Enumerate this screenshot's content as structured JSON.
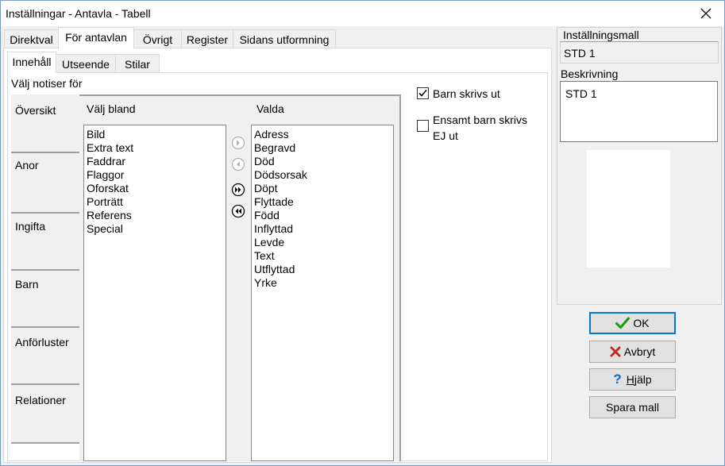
{
  "window": {
    "title": "Inställningar - Antavla - Tabell"
  },
  "main_tabs": [
    "Direktval",
    "För antavlan",
    "Övrigt",
    "Register",
    "Sidans utformning"
  ],
  "sub_tabs": [
    "Innehåll",
    "Utseende",
    "Stilar"
  ],
  "section_label": "Välj notiser för",
  "nav_items": [
    "Översikt",
    "Anor",
    "Ingifta",
    "Barn",
    "Anförluster",
    "Relationer"
  ],
  "choose_from": {
    "header": "Välj bland",
    "items": [
      "Bild",
      "Extra text",
      "Faddrar",
      "Flaggor",
      "Oforskat",
      "Porträtt",
      "Referens",
      "Special"
    ]
  },
  "selected": {
    "header": "Valda",
    "items": [
      "Adress",
      "Begravd",
      "Död",
      "Dödsorsak",
      "Döpt",
      "Flyttade",
      "Född",
      "Inflyttad",
      "Levde",
      "Text",
      "Utflyttad",
      "Yrke"
    ]
  },
  "options": {
    "barn_skrivs_ut": {
      "label": "Barn skrivs ut",
      "checked": true
    },
    "ensamt_barn": {
      "label_line1": "Ensamt barn skrivs",
      "label_line2": "EJ ut",
      "checked": false
    }
  },
  "template": {
    "label": "Inställningsmall",
    "value": "STD 1",
    "description_label": "Beskrivning",
    "description_value": "STD 1"
  },
  "buttons": {
    "ok": "OK",
    "cancel": "Avbryt",
    "help_prefix": "H",
    "help_rest": "jälp",
    "save_template": "Spara mall"
  },
  "colors": {
    "ok_check": "#1a9a1a",
    "cancel_x": "#c0282a",
    "help_q": "#1e64c8",
    "focus_border": "#0078d7"
  }
}
